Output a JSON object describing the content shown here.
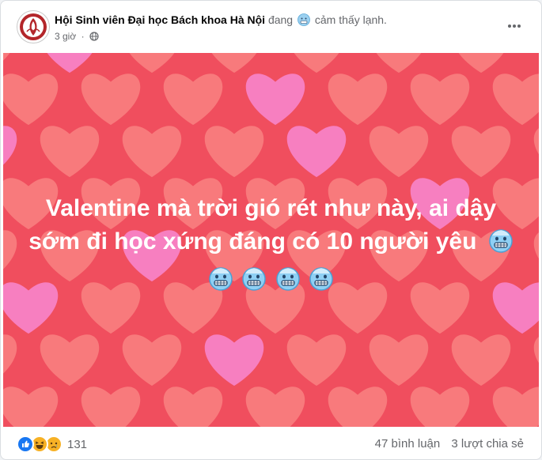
{
  "post": {
    "page_name": "Hội Sinh viên Đại học Bách khoa Hà Nội",
    "status_prefix": "đang",
    "feeling": "cảm thấy lạnh.",
    "feeling_icon": "cold-face-icon",
    "time": "3 giờ",
    "privacy_icon": "globe-icon",
    "more_icon": "more-options-icon"
  },
  "media": {
    "caption_line1": "Valentine mà trời gió rét như này, ai dậy",
    "caption_line2": "sớm đi học xứng đáng có 10 người yêu",
    "emoji_icon": "cold-face-icon",
    "background_color": "#f04e5e",
    "heart_colors": [
      "#f87a7c",
      "#f77fc0"
    ]
  },
  "footer": {
    "reaction_icons": [
      "like-icon",
      "haha-icon",
      "sad-icon"
    ],
    "reaction_count": "131",
    "comments": "47 bình luận",
    "shares": "3 lượt chia sẻ"
  }
}
